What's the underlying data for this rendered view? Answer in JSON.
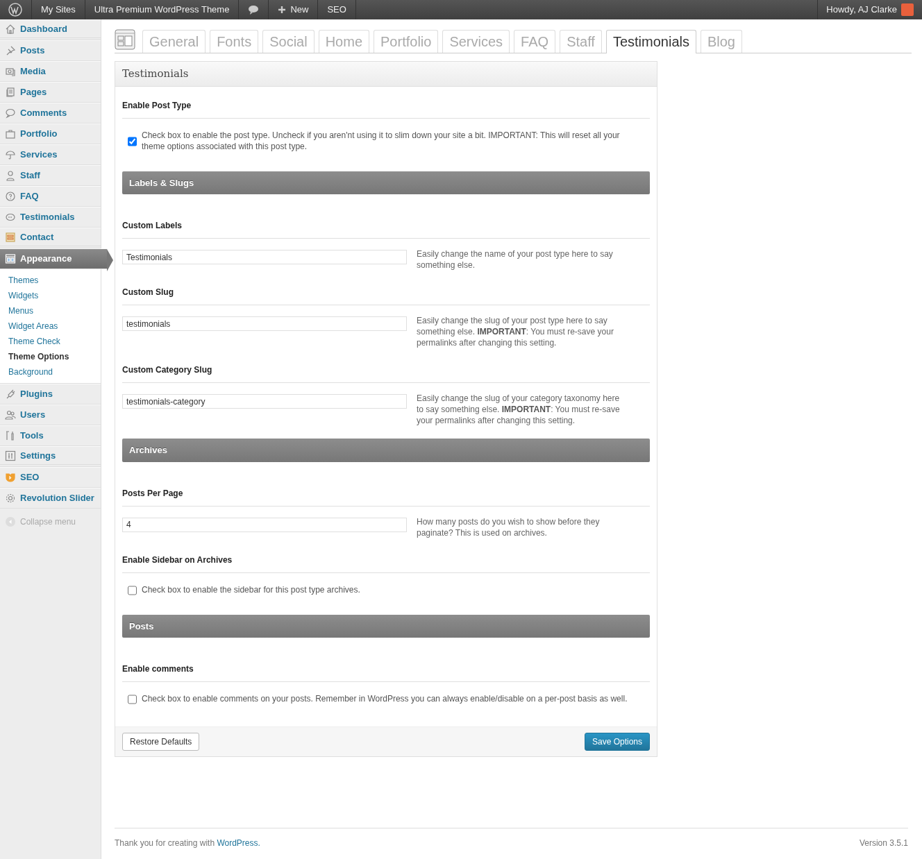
{
  "admin_bar": {
    "items": [
      {
        "kind": "logo"
      },
      {
        "kind": "text",
        "label": "My Sites"
      },
      {
        "kind": "text",
        "label": "Ultra Premium WordPress Theme"
      },
      {
        "kind": "comments"
      },
      {
        "kind": "new",
        "label": "New"
      },
      {
        "kind": "text",
        "label": "SEO"
      }
    ],
    "user": "Howdy, AJ Clarke"
  },
  "sidebar": {
    "groups": [
      [
        {
          "label": "Dashboard",
          "selected": false
        }
      ],
      [
        {
          "label": "Posts",
          "selected": false
        },
        {
          "label": "Media",
          "selected": false
        },
        {
          "label": "Pages",
          "selected": false
        },
        {
          "label": "Comments",
          "selected": false
        },
        {
          "label": "Portfolio",
          "selected": false
        },
        {
          "label": "Services",
          "selected": false
        },
        {
          "label": "Staff",
          "selected": false
        },
        {
          "label": "FAQ",
          "selected": false
        },
        {
          "label": "Testimonials",
          "selected": false
        },
        {
          "label": "Contact",
          "selected": false
        }
      ],
      [
        {
          "label": "Appearance",
          "selected": true,
          "children": [
            {
              "label": "Themes",
              "selected": false
            },
            {
              "label": "Widgets",
              "selected": false
            },
            {
              "label": "Menus",
              "selected": false
            },
            {
              "label": "Widget Areas",
              "selected": false
            },
            {
              "label": "Theme Check",
              "selected": false
            },
            {
              "label": "Theme Options",
              "selected": true
            },
            {
              "label": "Background",
              "selected": false
            }
          ]
        },
        {
          "label": "Plugins",
          "selected": false
        },
        {
          "label": "Users",
          "selected": false
        },
        {
          "label": "Tools",
          "selected": false
        },
        {
          "label": "Settings",
          "selected": false
        }
      ],
      [
        {
          "label": "SEO",
          "selected": false
        },
        {
          "label": "Revolution Slider",
          "selected": false
        }
      ]
    ],
    "collapse": "Collapse menu"
  },
  "tabs": [
    {
      "label": "General",
      "selected": false
    },
    {
      "label": "Fonts",
      "selected": false
    },
    {
      "label": "Social",
      "selected": false
    },
    {
      "label": "Home",
      "selected": false
    },
    {
      "label": "Portfolio",
      "selected": false
    },
    {
      "label": "Services",
      "selected": false
    },
    {
      "label": "FAQ",
      "selected": false
    },
    {
      "label": "Staff",
      "selected": false
    },
    {
      "label": "Testimonials",
      "selected": true
    },
    {
      "label": "Blog",
      "selected": false
    }
  ],
  "panel": {
    "title": "Testimonials",
    "sections": [
      {
        "kind": "checkbox",
        "heading": "Enable Post Type",
        "label": "Check box to enable the post type. Uncheck if you aren'nt using it to slim down your site a bit. IMPORTANT: This will reset all your theme options associated with this post type.",
        "checked": true
      },
      {
        "kind": "header",
        "label": "Labels & Slugs"
      },
      {
        "kind": "text",
        "heading": "Custom Labels",
        "value": "Testimonials",
        "help": "Easily change the name of your post type here to say something else."
      },
      {
        "kind": "text",
        "heading": "Custom Slug",
        "value": "testimonials",
        "help": "Easily change the slug of your post type here to say something else. **IMPORTANT**: You must re-save your permalinks after changing this setting."
      },
      {
        "kind": "text",
        "heading": "Custom Category Slug",
        "value": "testimonials-category",
        "help": "Easily change the slug of your category taxonomy here to say something else. **IMPORTANT**: You must re-save your permalinks after changing this setting."
      },
      {
        "kind": "header",
        "label": "Archives"
      },
      {
        "kind": "text",
        "heading": "Posts Per Page",
        "value": "4",
        "help": "How many posts do you wish to show before they paginate? This is used on archives."
      },
      {
        "kind": "checkbox",
        "heading": "Enable Sidebar on Archives",
        "label": "Check box to enable the sidebar for this post type archives.",
        "checked": false
      },
      {
        "kind": "header",
        "label": "Posts"
      },
      {
        "kind": "checkbox",
        "heading": "Enable comments",
        "label": "Check box to enable comments on your posts. Remember in WordPress you can always enable/disable on a per-post basis as well.",
        "checked": false
      }
    ],
    "restore_button": "Restore Defaults",
    "save_button": "Save Options"
  },
  "footer": {
    "thanks": "Thank you for creating with",
    "link": "WordPress.",
    "version": "Version 3.5.1"
  }
}
